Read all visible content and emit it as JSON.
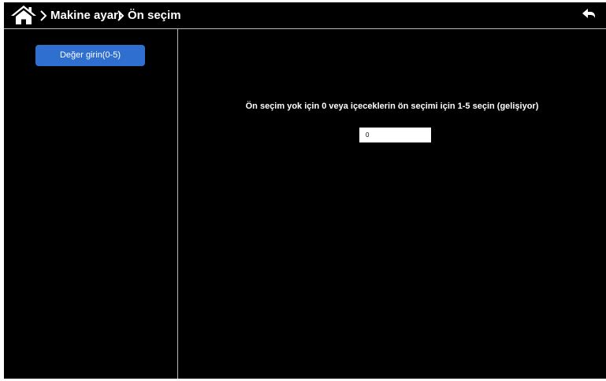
{
  "topbar": {
    "home_icon": "home-icon",
    "breadcrumb": [
      "Makine ayarı",
      "Ön seçim"
    ],
    "back_icon": "back-arrow-icon"
  },
  "sidebar": {
    "button_label": "Değer girin(0-5)"
  },
  "main": {
    "instruction": "Ön seçim yok için 0 veya içeceklerin ön seçimi için 1-5 seçin (gelişiyor)",
    "input_value": "0"
  },
  "colors": {
    "background": "#000000",
    "accent": "#2e6fd0",
    "divider": "#b8b8b8",
    "text": "#ffffff"
  }
}
